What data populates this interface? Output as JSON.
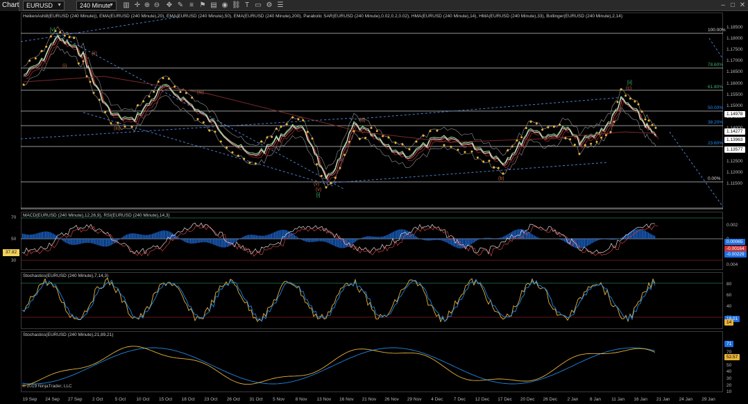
{
  "toolbar": {
    "chart_tab": "Chart",
    "instrument": "EURUSD",
    "interval": "240 Minute",
    "icons": [
      "bars-icon",
      "crosshair-icon",
      "zoom-in-icon",
      "zoom-out-icon",
      "move-icon",
      "draw-icon",
      "properties-icon",
      "strategy-icon",
      "data-box-icon",
      "snapshot-icon",
      "link-icon",
      "text-icon",
      "ruler-icon",
      "settings-icon",
      "list-icon"
    ],
    "window_controls": [
      "minimize-icon",
      "maximize-icon",
      "close-icon"
    ]
  },
  "price_panel": {
    "title": "HeikenAshi8(EURUSD (240 Minute)), EMA(EURUSD (240 Minute),20), EMA(EURUSD (240 Minute),50), EMA(EURUSD (240 Minute),200), Parabolic SAR(EURUSD (240 Minute),0.02,0.2,0.02), HMA(EURUSD (240 Minute),14), HMA(EURUSD (240 Minute),33), Bollinger(EURUSD (240 Minute),2,14)",
    "y_ticks": [
      "1.18500",
      "1.18000",
      "1.17500",
      "1.17000",
      "1.16500",
      "1.16000",
      "1.15500",
      "1.15000",
      "1.14500",
      "1.14000",
      "1.13500",
      "1.13000",
      "1.12500",
      "1.12000",
      "1.11500"
    ],
    "badges": [
      {
        "text": "1.14978",
        "bg": "#ffffff",
        "fg": "#000000"
      },
      {
        "text": "1.14277",
        "bg": "#ffffff",
        "fg": "#000000"
      },
      {
        "text": "1.13963",
        "bg": "#ffffff",
        "fg": "#000000"
      },
      {
        "text": "1.13577",
        "bg": "#ffffff",
        "fg": "#000000"
      }
    ],
    "fib_labels": [
      {
        "text": "100.00%",
        "color": "#dddddd"
      },
      {
        "text": "78.60%",
        "color": "#3cb371"
      },
      {
        "text": "61.80%",
        "color": "#3cb371"
      },
      {
        "text": "50.00%",
        "color": "#1e90ff"
      },
      {
        "text": "38.20%",
        "color": "#1e90ff"
      },
      {
        "text": "23.60%",
        "color": "#1e90ff"
      },
      {
        "text": "0.00%",
        "color": "#dddddd"
      }
    ],
    "wave_labels": [
      {
        "text": "(i)",
        "color": "#c0683c"
      },
      {
        "text": "(ii)",
        "color": "#c0683c"
      },
      {
        "text": "(iii)",
        "color": "#c0683c"
      },
      {
        "text": "(iv)",
        "color": "#c0683c"
      },
      {
        "text": "(v)",
        "color": "#c0683c"
      },
      {
        "text": "[i]",
        "color": "#3cb371"
      },
      {
        "text": "(a)",
        "color": "#c0683c"
      },
      {
        "text": "(b)",
        "color": "#c0683c"
      },
      {
        "text": "(c)",
        "color": "#c0683c"
      },
      {
        "text": "[ii]",
        "color": "#3cb371"
      },
      {
        "text": "[v]",
        "color": "#3cb371"
      },
      {
        "text": "(v)",
        "color": "#c0683c"
      }
    ]
  },
  "macd_panel": {
    "title": "MACD(EURUSD (240 Minute),12,26,9), RSI(EURUSD (240 Minute),14,3)",
    "left_ticks": [
      "70",
      "50",
      "30"
    ],
    "right_ticks": [
      "0.002",
      "0",
      "0.002",
      "0.004"
    ],
    "left_badge": "37.82",
    "badges": [
      {
        "text": "0.00065",
        "bg": "#1e6fe0",
        "fg": "#ffffff"
      },
      {
        "text": "-0.00164",
        "bg": "#d03030",
        "fg": "#ffffff"
      },
      {
        "text": "-0.00229",
        "bg": "#1e6fe0",
        "fg": "#ffffff"
      }
    ]
  },
  "stoch1_panel": {
    "title": "Stochastics(EURUSD (240 Minute),7,14,3)",
    "right_ticks": [
      "80",
      "60",
      "40",
      "20"
    ],
    "badges": [
      {
        "text": "18.01",
        "bg": "#1e6fe0",
        "fg": "#ffffff"
      },
      {
        "text": "14",
        "bg": "#e8b33a",
        "fg": "#000000"
      }
    ]
  },
  "stoch2_panel": {
    "title": "Stochastics(EURUSD (240 Minute),21,89,21)",
    "right_ticks": [
      "80",
      "70",
      "60",
      "50",
      "40",
      "30",
      "20",
      "10"
    ],
    "badges": [
      {
        "text": "71",
        "bg": "#1e6fe0",
        "fg": "#ffffff"
      },
      {
        "text": "52.57",
        "bg": "#e8b33a",
        "fg": "#000000"
      }
    ],
    "copyright": "© 2019 NinjaTrader, LLC"
  },
  "x_axis": [
    "19 Sep",
    "24 Sep",
    "27 Sep",
    "2 Oct",
    "5 Oct",
    "10 Oct",
    "15 Oct",
    "18 Oct",
    "23 Oct",
    "26 Oct",
    "31 Oct",
    "5 Nov",
    "8 Nov",
    "13 Nov",
    "16 Nov",
    "21 Nov",
    "26 Nov",
    "29 Nov",
    "4 Dec",
    "7 Dec",
    "12 Dec",
    "17 Dec",
    "20 Dec",
    "26 Dec",
    "2 Jan",
    "8 Jan",
    "11 Jan",
    "16 Jan",
    "21 Jan",
    "24 Jan",
    "29 Jan"
  ],
  "colors": {
    "bg": "#000000",
    "grid": "#1a1a1a",
    "trendline": "#4a7fd0",
    "fib_line": "#f0f0f0",
    "sar": "#f2b432",
    "ema20": "#e05050",
    "ema50": "#8a3030",
    "hma": "#9be09b",
    "bollinger": "#9a9a9a",
    "macd_hist": "#1e6fe0",
    "rsi": "#dddddd",
    "stoch_k": "#e8b33a",
    "stoch_d": "#1e88e5"
  }
}
